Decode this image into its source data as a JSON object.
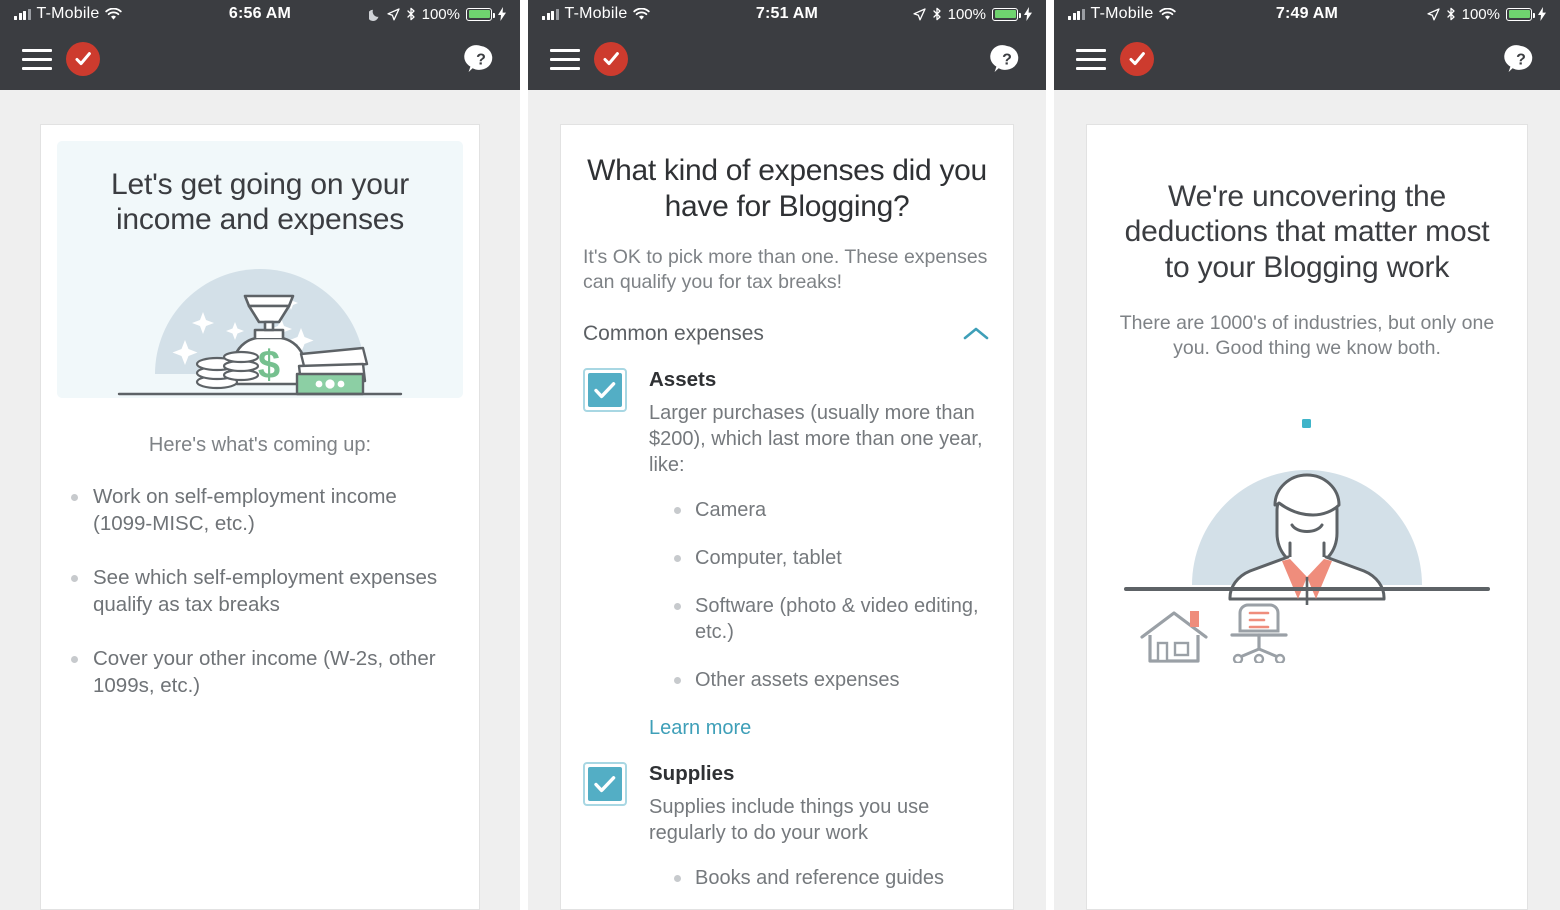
{
  "colors": {
    "navbar_bg": "#3b3d41",
    "page_bg": "#efefef",
    "brand_red": "#cd3b2e",
    "accent_teal": "#53aec5",
    "link_teal": "#3e9fb8",
    "money_green": "#76c08f",
    "illustration_blue": "#d3e0e8",
    "coral": "#ef8d7c",
    "battery_green": "#6fd36f"
  },
  "screens": [
    {
      "status": {
        "carrier": "T-Mobile",
        "time": "6:56 AM",
        "battery_percent": "100%",
        "icons": [
          "signal-bars-icon",
          "wifi-icon",
          "moon-icon",
          "location-arrow-icon",
          "bluetooth-icon",
          "battery-icon",
          "charging-bolt-icon"
        ]
      },
      "navbar": {
        "menu_icon": "hamburger-menu-icon",
        "logo_icon": "red-check-logo-icon",
        "help_icon": "help-speech-bubble-icon"
      },
      "hero": {
        "title": "Let's get going on your income and expenses",
        "illustration": "money-bag-coins-cash-illustration"
      },
      "coming_up_label": "Here's what's coming up:",
      "bullets": [
        "Work on self-employment income (1099-MISC, etc.)",
        "See which self-employment expenses qualify as tax breaks",
        "Cover your other income (W-2s, other 1099s, etc.)"
      ]
    },
    {
      "status": {
        "carrier": "T-Mobile",
        "time": "7:51 AM",
        "battery_percent": "100%",
        "icons": [
          "signal-bars-icon",
          "wifi-icon",
          "location-arrow-icon",
          "bluetooth-icon",
          "battery-icon",
          "charging-bolt-icon"
        ]
      },
      "navbar": {
        "menu_icon": "hamburger-menu-icon",
        "logo_icon": "red-check-logo-icon",
        "help_icon": "help-speech-bubble-icon"
      },
      "question": "What kind of expenses did you have for Blogging?",
      "subtitle": "It's OK to pick more than one. These expenses can qualify you for tax breaks!",
      "section": {
        "label": "Common expenses",
        "toggle_icon": "chevron-up-icon",
        "expanded": true
      },
      "options": [
        {
          "name": "Assets",
          "checked": true,
          "description": "Larger purchases (usually more than $200), which last more than one year, like:",
          "examples": [
            "Camera",
            "Computer, tablet",
            "Software (photo & video editing, etc.)",
            "Other assets expenses"
          ],
          "link": "Learn more"
        },
        {
          "name": "Supplies",
          "checked": true,
          "description": "Supplies include things you use regularly to do your work",
          "examples": [
            "Books and reference guides"
          ],
          "link": ""
        }
      ]
    },
    {
      "status": {
        "carrier": "T-Mobile",
        "time": "7:49 AM",
        "battery_percent": "100%",
        "icons": [
          "signal-bars-icon",
          "wifi-icon",
          "location-arrow-icon",
          "bluetooth-icon",
          "battery-icon",
          "charging-bolt-icon"
        ]
      },
      "navbar": {
        "menu_icon": "hamburger-menu-icon",
        "logo_icon": "red-check-logo-icon",
        "help_icon": "help-speech-bubble-icon"
      },
      "title": "We're uncovering the deductions that matter most to your Blogging work",
      "subtitle": "There are 1000's of industries, but only one you. Good thing we know both.",
      "illustration": "person-at-desk-with-house-and-office-chair-illustration"
    }
  ]
}
